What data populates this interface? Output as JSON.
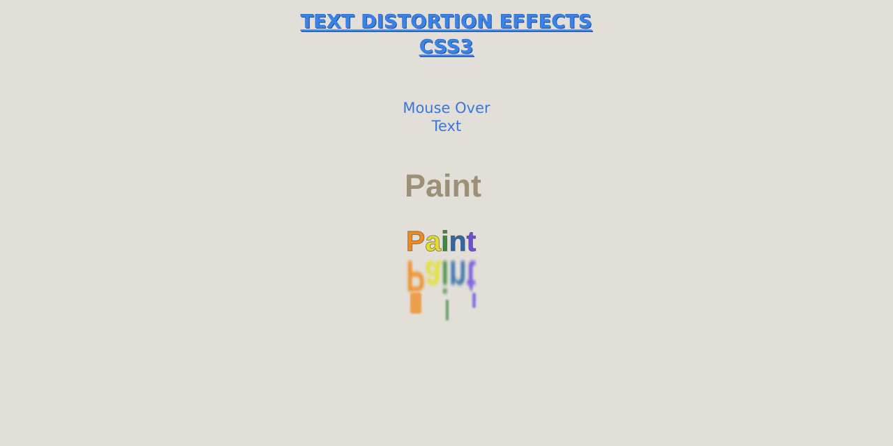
{
  "header": {
    "title_line1": "TEXT DISTORTION EFFECTS",
    "title_line2": "CSS3"
  },
  "instructions": {
    "line1": "Mouse Over",
    "line2": "Text"
  },
  "demo": {
    "plain_word": "Paint",
    "rainbow_letters": [
      "P",
      "a",
      "i",
      "n",
      "t"
    ]
  },
  "colors": {
    "background": "#e2dfd8",
    "title": "#3a82e6",
    "subtitle": "#3a78d8",
    "plain_word": "#9c9079",
    "rainbow": [
      "#f08a1c",
      "#e4e02a",
      "#3e8a3e",
      "#2f6aa8",
      "#6b4fe0"
    ]
  }
}
